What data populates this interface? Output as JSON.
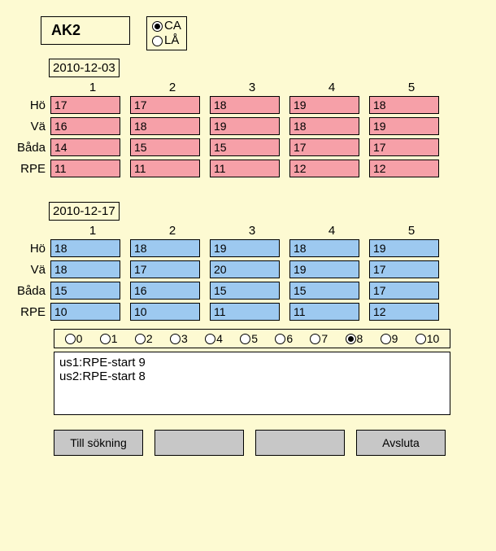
{
  "code": "AK2",
  "mode": {
    "options": [
      "CA",
      "LÅ"
    ],
    "selected": "CA"
  },
  "columns": [
    "1",
    "2",
    "3",
    "4",
    "5"
  ],
  "rowLabels": [
    "Hö",
    "Vä",
    "Båda",
    "RPE"
  ],
  "sessions": [
    {
      "date": "2010-12-03",
      "color": "pink",
      "rows": [
        [
          "17",
          "17",
          "18",
          "19",
          "18"
        ],
        [
          "16",
          "18",
          "19",
          "18",
          "19"
        ],
        [
          "14",
          "15",
          "15",
          "17",
          "17"
        ],
        [
          "11",
          "11",
          "11",
          "12",
          "12"
        ]
      ]
    },
    {
      "date": "2010-12-17",
      "color": "blue",
      "rows": [
        [
          "18",
          "18",
          "19",
          "18",
          "19"
        ],
        [
          "18",
          "17",
          "20",
          "19",
          "17"
        ],
        [
          "15",
          "16",
          "15",
          "15",
          "17"
        ],
        [
          "10",
          "10",
          "11",
          "11",
          "12"
        ]
      ]
    }
  ],
  "rpeScale": {
    "options": [
      "0",
      "1",
      "2",
      "3",
      "4",
      "5",
      "6",
      "7",
      "8",
      "9",
      "10"
    ],
    "selected": "8"
  },
  "notes": "us1:RPE-start 9\nus2:RPE-start 8",
  "buttons": {
    "search": "Till sökning",
    "b2": "",
    "b3": "",
    "quit": "Avsluta"
  }
}
